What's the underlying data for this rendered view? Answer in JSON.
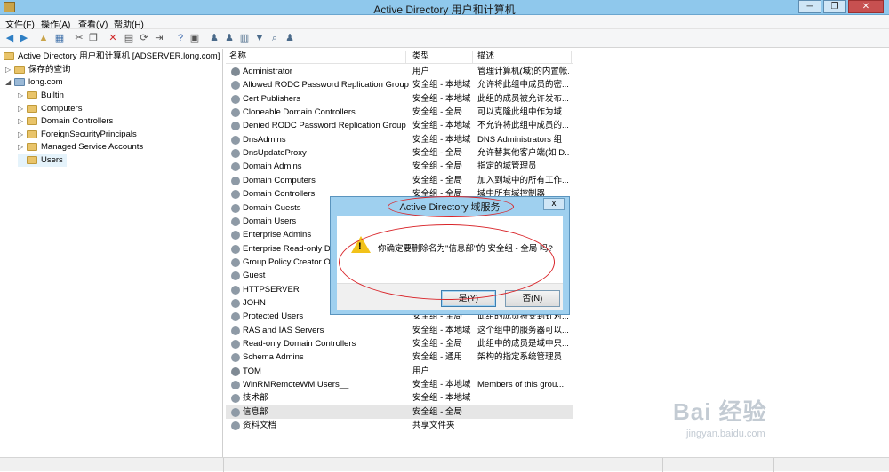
{
  "window": {
    "title": "Active Directory 用户和计算机"
  },
  "menu": [
    "文件(F)",
    "操作(A)",
    "查看(V)",
    "帮助(H)"
  ],
  "tree": {
    "root": "Active Directory 用户和计算机 [ADSERVER.long.com]",
    "saved_queries": "保存的查询",
    "domain": "long.com",
    "children": [
      "Builtin",
      "Computers",
      "Domain Controllers",
      "ForeignSecurityPrincipals",
      "Managed Service Accounts",
      "Users"
    ]
  },
  "columns": {
    "name": "名称",
    "type": "类型",
    "desc": "描述"
  },
  "rows": [
    {
      "name": "Administrator",
      "type": "用户",
      "desc": "管理计算机(域)的内置帐..."
    },
    {
      "name": "Allowed RODC Password Replication Group",
      "type": "安全组 - 本地域",
      "desc": "允许将此组中成员的密..."
    },
    {
      "name": "Cert Publishers",
      "type": "安全组 - 本地域",
      "desc": "此组的成员被允许发布..."
    },
    {
      "name": "Cloneable Domain Controllers",
      "type": "安全组 - 全局",
      "desc": "可以克隆此组中作为域..."
    },
    {
      "name": "Denied RODC Password Replication Group",
      "type": "安全组 - 本地域",
      "desc": "不允许将此组中成员的..."
    },
    {
      "name": "DnsAdmins",
      "type": "安全组 - 本地域",
      "desc": "DNS Administrators 组"
    },
    {
      "name": "DnsUpdateProxy",
      "type": "安全组 - 全局",
      "desc": "允许替其他客户端(如 D..."
    },
    {
      "name": "Domain Admins",
      "type": "安全组 - 全局",
      "desc": "指定的域管理员"
    },
    {
      "name": "Domain Computers",
      "type": "安全组 - 全局",
      "desc": "加入到域中的所有工作..."
    },
    {
      "name": "Domain Controllers",
      "type": "安全组 - 全局",
      "desc": "域中所有域控制器"
    },
    {
      "name": "Domain Guests",
      "type": "",
      "desc": ""
    },
    {
      "name": "Domain Users",
      "type": "",
      "desc": ""
    },
    {
      "name": "Enterprise Admins",
      "type": "",
      "desc": ""
    },
    {
      "name": "Enterprise Read-only D",
      "type": "",
      "desc": ""
    },
    {
      "name": "Group Policy Creator O",
      "type": "",
      "desc": ""
    },
    {
      "name": "Guest",
      "type": "",
      "desc": ""
    },
    {
      "name": "HTTPSERVER",
      "type": "",
      "desc": ""
    },
    {
      "name": "JOHN",
      "type": "",
      "desc": ""
    },
    {
      "name": "Protected Users",
      "type": "安全组 - 全局",
      "desc": "此组的成员将受到针对..."
    },
    {
      "name": "RAS and IAS Servers",
      "type": "安全组 - 本地域",
      "desc": "这个组中的服务器可以..."
    },
    {
      "name": "Read-only Domain Controllers",
      "type": "安全组 - 全局",
      "desc": "此组中的成员是域中只..."
    },
    {
      "name": "Schema Admins",
      "type": "安全组 - 通用",
      "desc": "架构的指定系统管理员"
    },
    {
      "name": "TOM",
      "type": "用户",
      "desc": ""
    },
    {
      "name": "WinRMRemoteWMIUsers__",
      "type": "安全组 - 本地域",
      "desc": "Members of this grou..."
    },
    {
      "name": "技术部",
      "type": "安全组 - 本地域",
      "desc": ""
    },
    {
      "name": "信息部",
      "type": "安全组 - 全局",
      "desc": ""
    },
    {
      "name": "资料文档",
      "type": "共享文件夹",
      "desc": ""
    }
  ],
  "dialog": {
    "title": "Active Directory 域服务",
    "message": "你确定要删除名为\"信息部\"的 安全组 - 全局 吗?",
    "yes": "是(Y)",
    "no": "否(N)",
    "close": "x"
  },
  "watermark": {
    "brand": "Bai 经验",
    "url": "jingyan.baidu.com"
  },
  "colors": {
    "titlebar": "#8fc8ec",
    "annotation": "#d9252a",
    "warning": "#f2c21a"
  }
}
